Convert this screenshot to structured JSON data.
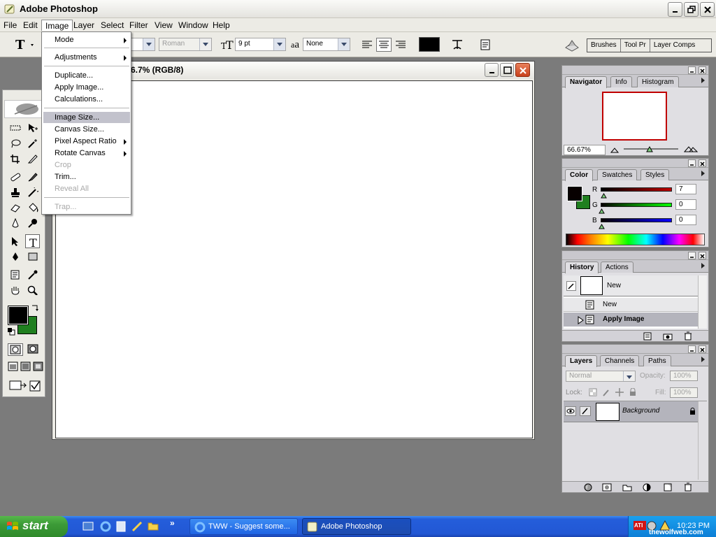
{
  "window": {
    "title": "Adobe Photoshop"
  },
  "menubar": [
    "File",
    "Edit",
    "Image",
    "Layer",
    "Select",
    "Filter",
    "View",
    "Window",
    "Help"
  ],
  "options": {
    "font_style": "Roman",
    "font_size": "9 pt",
    "antialias": "None",
    "text_color": "#000000",
    "palette_tabs": [
      "Brushes",
      "Tool Pr",
      "Layer Comps"
    ]
  },
  "image_menu": {
    "items": [
      {
        "label": "Mode"
      },
      {
        "label": "Adjustments"
      },
      {
        "label": "Duplicate..."
      },
      {
        "label": "Apply Image..."
      },
      {
        "label": "Calculations..."
      },
      {
        "label": "Image Size..."
      },
      {
        "label": "Canvas Size..."
      },
      {
        "label": "Pixel Aspect Ratio"
      },
      {
        "label": "Rotate Canvas"
      },
      {
        "label": "Crop"
      },
      {
        "label": "Trim..."
      },
      {
        "label": "Reveal All"
      },
      {
        "label": "Trap..."
      }
    ]
  },
  "document": {
    "title": "6.7% (RGB/8)"
  },
  "navigator": {
    "tabs": [
      "Navigator",
      "Info",
      "Histogram"
    ],
    "zoom": "66.67%"
  },
  "color": {
    "tabs": [
      "Color",
      "Swatches",
      "Styles"
    ],
    "channels": [
      {
        "label": "R",
        "value": "7",
        "color": "#c00000"
      },
      {
        "label": "G",
        "value": "0",
        "color": "#00a000"
      },
      {
        "label": "B",
        "value": "0",
        "color": "#0000c0"
      }
    ],
    "foreground": "#070000",
    "background": "#1f7f1f"
  },
  "history": {
    "tabs": [
      "History",
      "Actions"
    ],
    "snapshot": "New",
    "states": [
      "New",
      "Apply Image"
    ]
  },
  "layers": {
    "tabs": [
      "Layers",
      "Channels",
      "Paths"
    ],
    "blend_mode": "Normal",
    "opacity_label": "Opacity:",
    "opacity": "100%",
    "lock_label": "Lock:",
    "fill_label": "Fill:",
    "fill": "100%",
    "layer_name": "Background"
  },
  "taskbar": {
    "start": "start",
    "tasks": [
      "TWW - Suggest some...",
      "Adobe Photoshop"
    ],
    "tray_badge": "ATI",
    "clock": "10:23 PM",
    "watermark": "thewolfweb.com"
  }
}
